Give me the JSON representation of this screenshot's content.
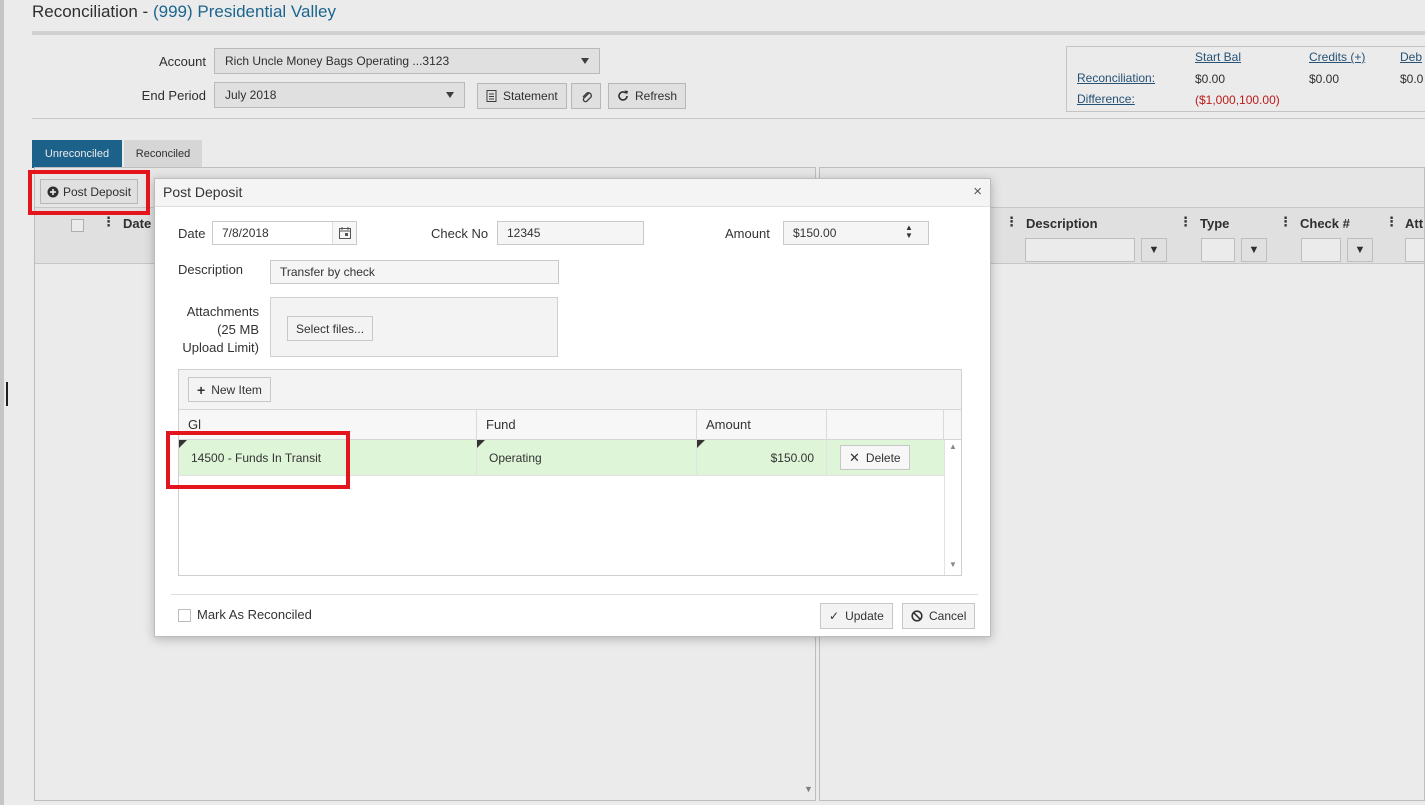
{
  "page": {
    "title_prefix": "Reconciliation - ",
    "title_property": "(999) Presidential Valley",
    "account_label": "Account",
    "account_value": "Rich Uncle Money Bags Operating ...3123",
    "end_period_label": "End Period",
    "end_period_value": "July 2018",
    "statement_button": "Statement",
    "refresh_button": "Refresh",
    "summary": {
      "start_bal_header": "Start Bal",
      "credits_header": "Credits (+)",
      "debits_header": "Deb",
      "reconciliation_label": "Reconciliation:",
      "difference_label": "Difference:",
      "rec_start_bal": "$0.00",
      "rec_credits": "$0.00",
      "rec_debits": "$0.0",
      "diff_start_bal": "($1,000,100.00)"
    },
    "tabs": {
      "unreconciled": "Unreconciled",
      "reconciled": "Reconciled"
    },
    "post_deposit_button": "Post Deposit",
    "left_grid": {
      "date_header": "Date"
    },
    "right_grid": {
      "description_header": "Description",
      "type_header": "Type",
      "check_header": "Check #",
      "att_header": "Att"
    }
  },
  "modal": {
    "title": "Post Deposit",
    "close_glyph": "×",
    "date_label": "Date",
    "date_value": "7/8/2018",
    "check_no_label": "Check No",
    "check_no_value": "12345",
    "amount_label": "Amount",
    "amount_value": "$150.00",
    "description_label": "Description",
    "description_value": "Transfer by check",
    "attachments_label_1": "Attachments",
    "attachments_label_2": "(25 MB",
    "attachments_label_3": "Upload Limit)",
    "select_files_button": "Select files...",
    "new_item_button": "New Item",
    "columns": {
      "gl": "Gl",
      "fund": "Fund",
      "amount": "Amount"
    },
    "rows": [
      {
        "gl": "14500 - Funds In Transit",
        "fund": "Operating",
        "amount": "$150.00",
        "delete": "Delete"
      }
    ],
    "mark_reconciled_label": "Mark As Reconciled",
    "update_button": "Update",
    "cancel_button": "Cancel"
  },
  "colors": {
    "accent": "#1e6a96",
    "highlight": "#e3141b",
    "row_green": "#dff5d8"
  },
  "icons": [
    "calendar-icon",
    "spinner-arrows-icon",
    "statement-icon",
    "paperclip-icon",
    "refresh-icon",
    "plus-circle-icon",
    "plus-icon",
    "x-icon",
    "check-icon",
    "ban-icon",
    "filter-icon",
    "kebab-icon",
    "close-icon",
    "caret-down-icon"
  ]
}
